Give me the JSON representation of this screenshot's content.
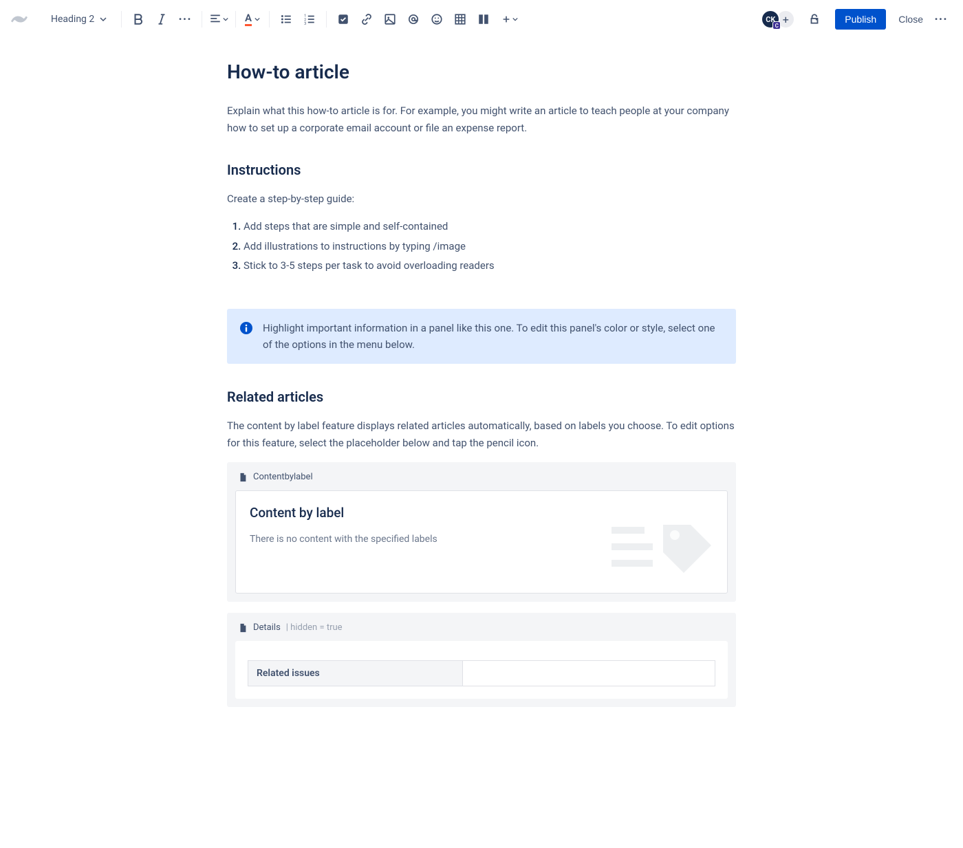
{
  "toolbar": {
    "heading_label": "Heading 2",
    "publish_label": "Publish",
    "close_label": "Close"
  },
  "avatar": {
    "initials": "CK",
    "badge": "C"
  },
  "page": {
    "title": "How-to article",
    "intro": "Explain what this how-to article is for. For example, you might write an article to teach people at your company how to set up a corporate email account or file an expense report.",
    "instructions_heading": "Instructions",
    "instructions_lead": "Create a step-by-step guide:",
    "steps": [
      "Add steps that are simple and self-contained",
      "Add illustrations to instructions by typing /image",
      "Stick to 3-5 steps per task to avoid overloading readers"
    ],
    "info_panel": "Highlight important information in a panel like this one. To edit this panel's color or style, select one of the options in the menu below.",
    "related_heading": "Related articles",
    "related_lead": "The content by label feature displays related articles automatically, based on labels you choose. To edit options for this feature, select the placeholder below and tap the pencil icon."
  },
  "macros": {
    "contentbylabel": {
      "header": "Contentbylabel",
      "title": "Content by label",
      "empty": "There is no content with the specified labels"
    },
    "details": {
      "header": "Details",
      "meta": "| hidden = true",
      "row_label": "Related issues",
      "row_value": ""
    }
  }
}
